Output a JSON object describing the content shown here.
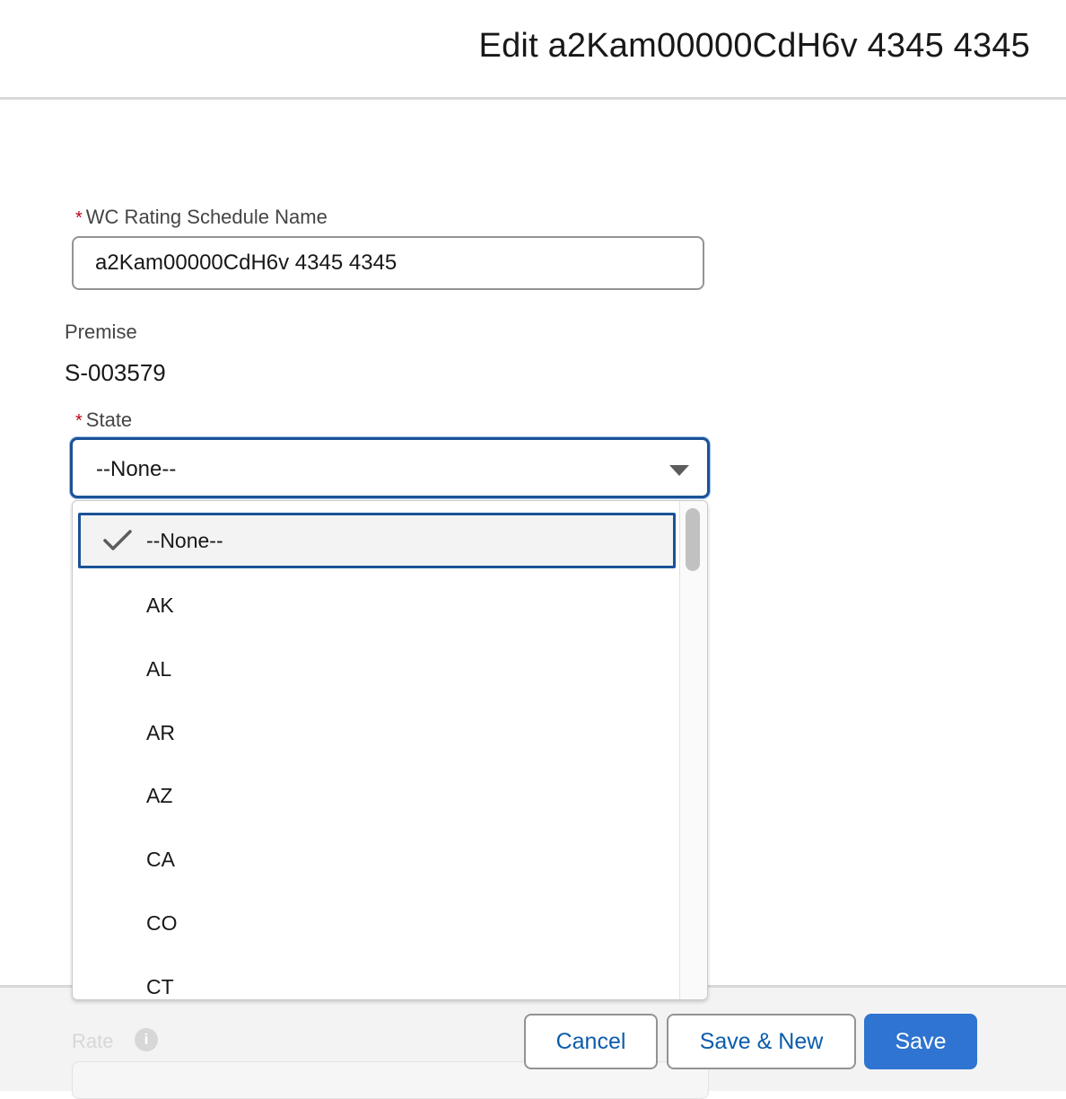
{
  "modal": {
    "title": "Edit a2Kam00000CdH6v 4345 4345"
  },
  "form": {
    "name_field": {
      "required_marker": "*",
      "label": "WC Rating Schedule Name",
      "value": "a2Kam00000CdH6v 4345 4345"
    },
    "premise_field": {
      "label": "Premise",
      "value": "S-003579"
    },
    "state_field": {
      "required_marker": "*",
      "label": "State",
      "selected": "--None--",
      "options": [
        "--None--",
        "AK",
        "AL",
        "AR",
        "AZ",
        "CA",
        "CO",
        "CT"
      ]
    },
    "rate_field": {
      "label": "Rate",
      "info_glyph": "i"
    }
  },
  "footer": {
    "cancel_label": "Cancel",
    "save_new_label": "Save & New",
    "save_label": "Save"
  },
  "colors": {
    "brand": "#2e74d0",
    "focus_border": "#1b5297",
    "required": "#ba0517",
    "link_text": "#0b5cab"
  }
}
